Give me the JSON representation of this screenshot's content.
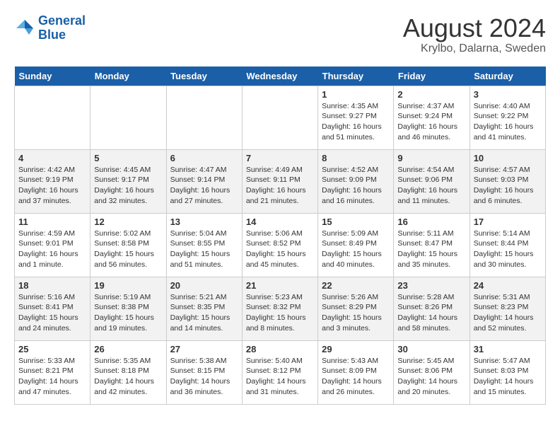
{
  "header": {
    "logo_line1": "General",
    "logo_line2": "Blue",
    "month_year": "August 2024",
    "location": "Krylbo, Dalarna, Sweden"
  },
  "days_of_week": [
    "Sunday",
    "Monday",
    "Tuesday",
    "Wednesday",
    "Thursday",
    "Friday",
    "Saturday"
  ],
  "weeks": [
    [
      {
        "day": "",
        "info": ""
      },
      {
        "day": "",
        "info": ""
      },
      {
        "day": "",
        "info": ""
      },
      {
        "day": "",
        "info": ""
      },
      {
        "day": "1",
        "info": "Sunrise: 4:35 AM\nSunset: 9:27 PM\nDaylight: 16 hours\nand 51 minutes."
      },
      {
        "day": "2",
        "info": "Sunrise: 4:37 AM\nSunset: 9:24 PM\nDaylight: 16 hours\nand 46 minutes."
      },
      {
        "day": "3",
        "info": "Sunrise: 4:40 AM\nSunset: 9:22 PM\nDaylight: 16 hours\nand 41 minutes."
      }
    ],
    [
      {
        "day": "4",
        "info": "Sunrise: 4:42 AM\nSunset: 9:19 PM\nDaylight: 16 hours\nand 37 minutes."
      },
      {
        "day": "5",
        "info": "Sunrise: 4:45 AM\nSunset: 9:17 PM\nDaylight: 16 hours\nand 32 minutes."
      },
      {
        "day": "6",
        "info": "Sunrise: 4:47 AM\nSunset: 9:14 PM\nDaylight: 16 hours\nand 27 minutes."
      },
      {
        "day": "7",
        "info": "Sunrise: 4:49 AM\nSunset: 9:11 PM\nDaylight: 16 hours\nand 21 minutes."
      },
      {
        "day": "8",
        "info": "Sunrise: 4:52 AM\nSunset: 9:09 PM\nDaylight: 16 hours\nand 16 minutes."
      },
      {
        "day": "9",
        "info": "Sunrise: 4:54 AM\nSunset: 9:06 PM\nDaylight: 16 hours\nand 11 minutes."
      },
      {
        "day": "10",
        "info": "Sunrise: 4:57 AM\nSunset: 9:03 PM\nDaylight: 16 hours\nand 6 minutes."
      }
    ],
    [
      {
        "day": "11",
        "info": "Sunrise: 4:59 AM\nSunset: 9:01 PM\nDaylight: 16 hours\nand 1 minute."
      },
      {
        "day": "12",
        "info": "Sunrise: 5:02 AM\nSunset: 8:58 PM\nDaylight: 15 hours\nand 56 minutes."
      },
      {
        "day": "13",
        "info": "Sunrise: 5:04 AM\nSunset: 8:55 PM\nDaylight: 15 hours\nand 51 minutes."
      },
      {
        "day": "14",
        "info": "Sunrise: 5:06 AM\nSunset: 8:52 PM\nDaylight: 15 hours\nand 45 minutes."
      },
      {
        "day": "15",
        "info": "Sunrise: 5:09 AM\nSunset: 8:49 PM\nDaylight: 15 hours\nand 40 minutes."
      },
      {
        "day": "16",
        "info": "Sunrise: 5:11 AM\nSunset: 8:47 PM\nDaylight: 15 hours\nand 35 minutes."
      },
      {
        "day": "17",
        "info": "Sunrise: 5:14 AM\nSunset: 8:44 PM\nDaylight: 15 hours\nand 30 minutes."
      }
    ],
    [
      {
        "day": "18",
        "info": "Sunrise: 5:16 AM\nSunset: 8:41 PM\nDaylight: 15 hours\nand 24 minutes."
      },
      {
        "day": "19",
        "info": "Sunrise: 5:19 AM\nSunset: 8:38 PM\nDaylight: 15 hours\nand 19 minutes."
      },
      {
        "day": "20",
        "info": "Sunrise: 5:21 AM\nSunset: 8:35 PM\nDaylight: 15 hours\nand 14 minutes."
      },
      {
        "day": "21",
        "info": "Sunrise: 5:23 AM\nSunset: 8:32 PM\nDaylight: 15 hours\nand 8 minutes."
      },
      {
        "day": "22",
        "info": "Sunrise: 5:26 AM\nSunset: 8:29 PM\nDaylight: 15 hours\nand 3 minutes."
      },
      {
        "day": "23",
        "info": "Sunrise: 5:28 AM\nSunset: 8:26 PM\nDaylight: 14 hours\nand 58 minutes."
      },
      {
        "day": "24",
        "info": "Sunrise: 5:31 AM\nSunset: 8:23 PM\nDaylight: 14 hours\nand 52 minutes."
      }
    ],
    [
      {
        "day": "25",
        "info": "Sunrise: 5:33 AM\nSunset: 8:21 PM\nDaylight: 14 hours\nand 47 minutes."
      },
      {
        "day": "26",
        "info": "Sunrise: 5:35 AM\nSunset: 8:18 PM\nDaylight: 14 hours\nand 42 minutes."
      },
      {
        "day": "27",
        "info": "Sunrise: 5:38 AM\nSunset: 8:15 PM\nDaylight: 14 hours\nand 36 minutes."
      },
      {
        "day": "28",
        "info": "Sunrise: 5:40 AM\nSunset: 8:12 PM\nDaylight: 14 hours\nand 31 minutes."
      },
      {
        "day": "29",
        "info": "Sunrise: 5:43 AM\nSunset: 8:09 PM\nDaylight: 14 hours\nand 26 minutes."
      },
      {
        "day": "30",
        "info": "Sunrise: 5:45 AM\nSunset: 8:06 PM\nDaylight: 14 hours\nand 20 minutes."
      },
      {
        "day": "31",
        "info": "Sunrise: 5:47 AM\nSunset: 8:03 PM\nDaylight: 14 hours\nand 15 minutes."
      }
    ]
  ]
}
